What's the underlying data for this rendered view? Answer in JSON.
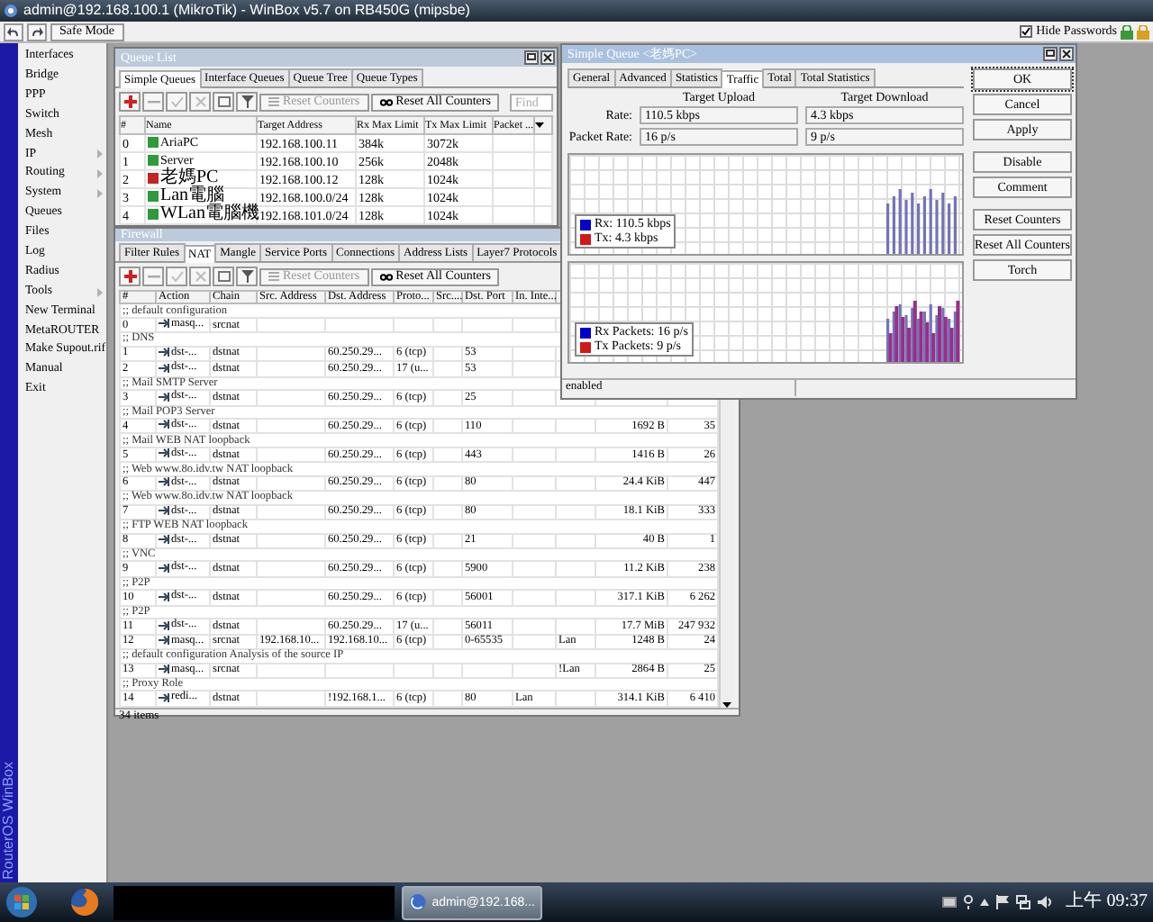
{
  "window": {
    "title": "admin@192.168.100.1 (MikroTik) - WinBox v5.7 on RB450G (mipsbe)"
  },
  "toolbar": {
    "safe_mode": "Safe Mode",
    "hide_passwords": {
      "label": "Hide Passwords",
      "checked": true
    }
  },
  "sidebar": {
    "brand": "RouterOS WinBox",
    "items": [
      {
        "label": "Interfaces",
        "submenu": false
      },
      {
        "label": "Bridge",
        "submenu": false
      },
      {
        "label": "PPP",
        "submenu": false
      },
      {
        "label": "Switch",
        "submenu": false
      },
      {
        "label": "Mesh",
        "submenu": false
      },
      {
        "label": "IP",
        "submenu": true
      },
      {
        "label": "Routing",
        "submenu": true
      },
      {
        "label": "System",
        "submenu": true
      },
      {
        "label": "Queues",
        "submenu": false
      },
      {
        "label": "Files",
        "submenu": false
      },
      {
        "label": "Log",
        "submenu": false
      },
      {
        "label": "Radius",
        "submenu": false
      },
      {
        "label": "Tools",
        "submenu": true
      },
      {
        "label": "New Terminal",
        "submenu": false
      },
      {
        "label": "MetaROUTER",
        "submenu": false
      },
      {
        "label": "Make Supout.rif",
        "submenu": false
      },
      {
        "label": "Manual",
        "submenu": false
      },
      {
        "label": "Exit",
        "submenu": false
      }
    ]
  },
  "queue_list": {
    "title": "Queue List",
    "tabs": [
      {
        "label": "Simple Queues",
        "selected": true
      },
      {
        "label": "Interface Queues",
        "selected": false
      },
      {
        "label": "Queue Tree",
        "selected": false
      },
      {
        "label": "Queue Types",
        "selected": false
      }
    ],
    "reset_counters": "Reset Counters",
    "reset_all_counters": "Reset All Counters",
    "find_placeholder": "Find",
    "columns": [
      "#",
      "Name",
      "Target Address",
      "Rx Max Limit",
      "Tx Max Limit",
      "Packet ..."
    ],
    "rows": [
      {
        "num": "0",
        "name": "AriaPC",
        "target": "192.168.100.11",
        "rx": "384k",
        "tx": "3072k",
        "color": "#2e9a3c"
      },
      {
        "num": "1",
        "name": "Server",
        "target": "192.168.100.10",
        "rx": "256k",
        "tx": "2048k",
        "color": "#2e9a3c"
      },
      {
        "num": "2",
        "name": "老媽PC",
        "target": "192.168.100.12",
        "rx": "128k",
        "tx": "1024k",
        "color": "#c42424"
      },
      {
        "num": "3",
        "name": "Lan電腦",
        "target": "192.168.100.0/24",
        "rx": "128k",
        "tx": "1024k",
        "color": "#2e9a3c"
      },
      {
        "num": "4",
        "name": "WLan電腦機",
        "target": "192.168.101.0/24",
        "rx": "128k",
        "tx": "1024k",
        "color": "#2e9a3c"
      }
    ]
  },
  "firewall": {
    "title": "Firewall",
    "tabs": [
      {
        "label": "Filter Rules",
        "selected": false
      },
      {
        "label": "NAT",
        "selected": true
      },
      {
        "label": "Mangle",
        "selected": false
      },
      {
        "label": "Service Ports",
        "selected": false
      },
      {
        "label": "Connections",
        "selected": false
      },
      {
        "label": "Address Lists",
        "selected": false
      },
      {
        "label": "Layer7 Protocols",
        "selected": false
      }
    ],
    "reset_counters": "Reset Counters",
    "reset_all_counters": "Reset All Counters",
    "columns": [
      "#",
      "Action",
      "Chain",
      "Src. Address",
      "Dst. Address",
      "Proto...",
      "Src....",
      "Dst. Port",
      "In. Inte..."
    ],
    "rows": [
      {
        "kind": "comment",
        "text": ";; default configuration"
      },
      {
        "kind": "rule",
        "num": "0",
        "action": "masq...",
        "chain": "srcnat"
      },
      {
        "kind": "comment",
        "text": ";; DNS"
      },
      {
        "kind": "rule",
        "num": "1",
        "action": "dst-...",
        "chain": "dstnat",
        "dst_address": "60.250.29...",
        "protocol": "6 (tcp)",
        "dst_port": "53"
      },
      {
        "kind": "rule",
        "num": "2",
        "action": "dst-...",
        "chain": "dstnat",
        "dst_address": "60.250.29...",
        "protocol": "17 (u...",
        "dst_port": "53"
      },
      {
        "kind": "comment",
        "text": ";; Mail SMTP Server"
      },
      {
        "kind": "rule",
        "num": "3",
        "action": "dst-...",
        "chain": "dstnat",
        "dst_address": "60.250.29...",
        "protocol": "6 (tcp)",
        "dst_port": "25"
      },
      {
        "kind": "comment",
        "text": ";; Mail POP3 Server"
      },
      {
        "kind": "rule",
        "num": "4",
        "action": "dst-...",
        "chain": "dstnat",
        "dst_address": "60.250.29...",
        "protocol": "6 (tcp)",
        "dst_port": "110",
        "column_11": "1692 B",
        "column_12": "35"
      },
      {
        "kind": "comment",
        "text": ";; Mail WEB NAT loopback"
      },
      {
        "kind": "rule",
        "num": "5",
        "action": "dst-...",
        "chain": "dstnat",
        "dst_address": "60.250.29...",
        "protocol": "6 (tcp)",
        "dst_port": "443",
        "column_11": "1416 B",
        "column_12": "26"
      },
      {
        "kind": "comment",
        "text": ";; Web www.8o.idv.tw NAT loopback"
      },
      {
        "kind": "rule",
        "num": "6",
        "action": "dst-...",
        "chain": "dstnat",
        "dst_address": "60.250.29...",
        "protocol": "6 (tcp)",
        "dst_port": "80",
        "column_11": "24.4 KiB",
        "column_12": "447"
      },
      {
        "kind": "comment",
        "text": ";; Web www.8o.idv.tw NAT loopback"
      },
      {
        "kind": "rule",
        "num": "7",
        "action": "dst-...",
        "chain": "dstnat",
        "dst_address": "60.250.29...",
        "protocol": "6 (tcp)",
        "dst_port": "80",
        "column_11": "18.1 KiB",
        "column_12": "333"
      },
      {
        "kind": "comment",
        "text": ";; FTP WEB NAT loopback"
      },
      {
        "kind": "rule",
        "num": "8",
        "action": "dst-...",
        "chain": "dstnat",
        "dst_address": "60.250.29...",
        "protocol": "6 (tcp)",
        "dst_port": "21",
        "column_11": "40 B",
        "column_12": "1"
      },
      {
        "kind": "comment",
        "text": ";; VNC"
      },
      {
        "kind": "rule",
        "num": "9",
        "action": "dst-...",
        "chain": "dstnat",
        "dst_address": "60.250.29...",
        "protocol": "6 (tcp)",
        "dst_port": "5900",
        "column_11": "11.2 KiB",
        "column_12": "238"
      },
      {
        "kind": "comment",
        "text": ";; P2P"
      },
      {
        "kind": "rule",
        "num": "10",
        "action": "dst-...",
        "chain": "dstnat",
        "dst_address": "60.250.29...",
        "protocol": "6 (tcp)",
        "dst_port": "56001",
        "column_11": "317.1 KiB",
        "column_12": "6 262"
      },
      {
        "kind": "comment",
        "text": ";; P2P"
      },
      {
        "kind": "rule",
        "num": "11",
        "action": "dst-...",
        "chain": "dstnat",
        "dst_address": "60.250.29...",
        "protocol": "17 (u...",
        "dst_port": "56011",
        "column_11": "17.7 MiB",
        "column_12": "247 932"
      },
      {
        "kind": "rule",
        "num": "12",
        "action": "masq...",
        "chain": "srcnat",
        "src_address": "192.168.10...",
        "dst_address": "192.168.10...",
        "protocol": "6 (tcp)",
        "dst_port": "0-65535",
        "column_10": "Lan",
        "column_11": "1248 B",
        "column_12": "24"
      },
      {
        "kind": "comment",
        "text": ";; default configuration  Analysis of the source IP"
      },
      {
        "kind": "rule",
        "num": "13",
        "action": "masq...",
        "chain": "srcnat",
        "column_10": "!Lan",
        "column_11": "2864 B",
        "column_12": "25"
      },
      {
        "kind": "comment",
        "text": ";; Proxy Role"
      },
      {
        "kind": "rule",
        "num": "14",
        "action": "redi...",
        "chain": "dstnat",
        "dst_address": "!192.168.1...",
        "protocol": "6 (tcp)",
        "dst_port": "80",
        "in_interface": "Lan",
        "column_11": "314.1 KiB",
        "column_12": "6 410"
      }
    ],
    "status": "34 items"
  },
  "simple_queue": {
    "title": "Simple Queue <老媽PC>",
    "tabs": [
      {
        "label": "General",
        "selected": false
      },
      {
        "label": "Advanced",
        "selected": false
      },
      {
        "label": "Statistics",
        "selected": false
      },
      {
        "label": "Traffic",
        "selected": true
      },
      {
        "label": "Total",
        "selected": false
      },
      {
        "label": "Total Statistics",
        "selected": false
      }
    ],
    "headings": [
      "Target Upload",
      "Target Download"
    ],
    "fields": [
      {
        "label": "Rate:",
        "upload": "110.5 kbps",
        "download": "4.3 kbps"
      },
      {
        "label": "Packet Rate:",
        "upload": "16 p/s",
        "download": "9 p/s"
      }
    ],
    "graphs": [
      {
        "legend": [
          {
            "label": "Rx:  110.5 kbps",
            "color": "#0000c8"
          },
          {
            "label": "Tx:  4.3 kbps",
            "color": "#d01818"
          }
        ]
      },
      {
        "legend": [
          {
            "label": "Rx Packets:  16 p/s",
            "color": "#0000c8"
          },
          {
            "label": "Tx Packets:  9 p/s",
            "color": "#d01818"
          }
        ]
      }
    ],
    "status": "enabled",
    "buttons": [
      [
        "OK",
        "Cancel",
        "Apply"
      ],
      [
        "Disable",
        "Comment"
      ],
      [
        "Reset Counters",
        "Reset All Counters",
        "Torch"
      ]
    ]
  },
  "taskbar": {
    "task": "admin@192.168...",
    "clock": "上午 09:37"
  }
}
